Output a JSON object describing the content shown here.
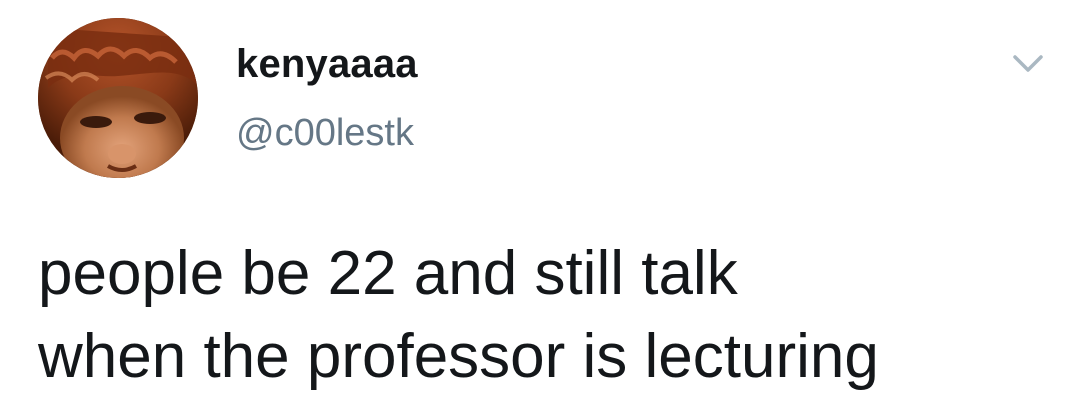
{
  "tweet": {
    "author": {
      "display_name": "kenyaaaa",
      "handle": "@c00lestk"
    },
    "menu_icon": "chevron-down-icon",
    "text_lines": [
      "people be 22 and still talk",
      "when the professor is lecturing"
    ]
  },
  "colors": {
    "name": "#14171a",
    "handle": "#657786",
    "chevron": "#aab8c2",
    "background": "#ffffff"
  }
}
